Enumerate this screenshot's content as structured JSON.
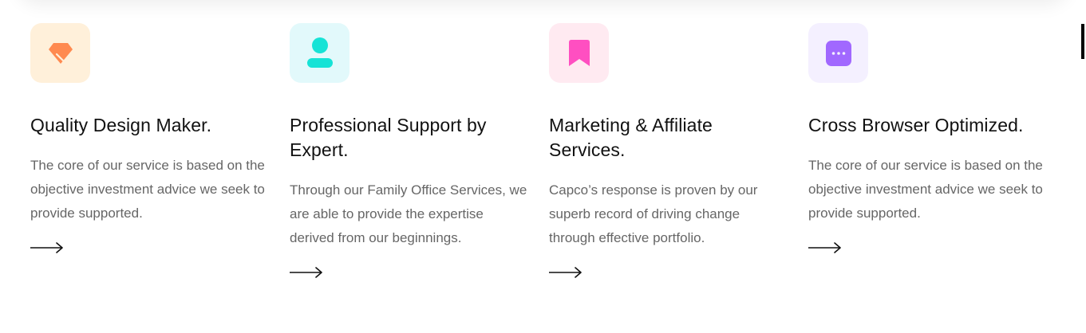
{
  "features": [
    {
      "icon": "diamond-icon",
      "icon_bg": "#FFF0DA",
      "icon_color": "#FF8A50",
      "title": "Quality Design Maker.",
      "description": "The core of our service is based on the objective investment advice we seek to provide supported."
    },
    {
      "icon": "user-icon",
      "icon_bg": "#E2F9FB",
      "icon_color": "#16E3D6",
      "title": "Professional Support by Expert.",
      "description": "Through our Family Office Services, we are able to provide the expertise derived from our beginnings."
    },
    {
      "icon": "bookmark-icon",
      "icon_bg": "#FFEAF1",
      "icon_color": "#FF4FC1",
      "title": "Marketing & Affiliate Services.",
      "description": "Capco’s response is proven by our superb record of driving change through effective portfolio."
    },
    {
      "icon": "chat-bubble-icon",
      "icon_bg": "#F4F0FF",
      "icon_color": "#A168FF",
      "title": "Cross Browser Optimized.",
      "description": "The core of our service is based on the objective investment advice we seek to provide supported."
    }
  ]
}
